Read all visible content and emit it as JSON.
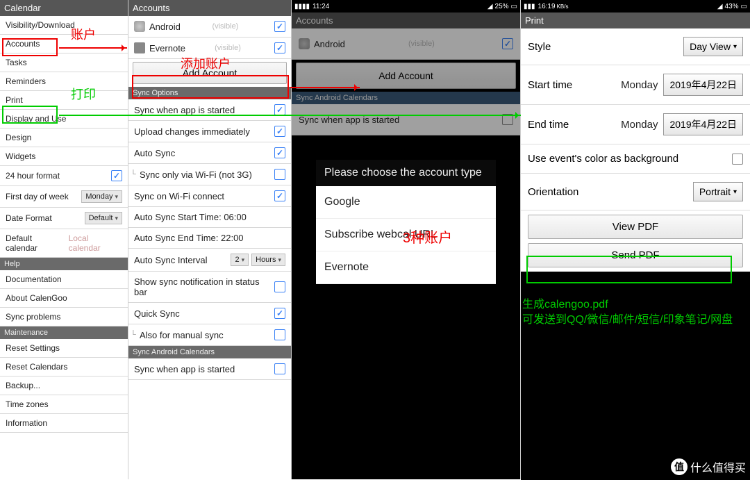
{
  "c1": {
    "hdr": "Calendar",
    "items": [
      "Visibility/Download",
      "Accounts",
      "Tasks",
      "Reminders",
      "Print",
      "Display and Use",
      "Design",
      "Widgets"
    ],
    "h24": "24 hour format",
    "fdow": "First day of week",
    "fdowv": "Monday",
    "dfmt": "Date Format",
    "dfmtv": "Default",
    "dcal": "Default calendar",
    "dcalv": "Local calendar",
    "help": "Help",
    "hitems": [
      "Documentation",
      "About CalenGoo",
      "Sync problems"
    ],
    "maint": "Maintenance",
    "mitems": [
      "Reset Settings",
      "Reset Calendars",
      "Backup...",
      "Time zones",
      "Information"
    ]
  },
  "c2": {
    "hdr": "Accounts",
    "a1": "Android",
    "a2": "Evernote",
    "vis": "(visible)",
    "add": "Add Account",
    "sync": "Sync Options",
    "o1": "Sync when app is started",
    "o2": "Upload changes immediately",
    "o3": "Auto Sync",
    "o4": "Sync only via Wi-Fi (not 3G)",
    "o5": "Sync on Wi-Fi connect",
    "o6": "Auto Sync Start Time: 06:00",
    "o7": "Auto Sync End Time: 22:00",
    "o8": "Auto Sync Interval",
    "o8a": "2",
    "o8b": "Hours",
    "o9": "Show sync notification in status bar",
    "o10": "Quick Sync",
    "o11": "Also for manual sync",
    "sac": "Sync Android Calendars",
    "o12": "Sync when app is started"
  },
  "c3": {
    "sb": "11:24",
    "sbr": "25%",
    "hdr": "Accounts",
    "a1": "Android",
    "vis": "(visible)",
    "add": "Add Account",
    "sac": "Sync Android Calendars",
    "o1": "Sync when app is started",
    "dlgh": "Please choose the account type",
    "d1": "Google",
    "d2": "Subscribe webcal URL",
    "d3": "Evernote"
  },
  "c4": {
    "sb": "16:19",
    "sbk": "KB/s",
    "sbr": "43%",
    "hdr": "Print",
    "style": "Style",
    "stylev": "Day View",
    "st": "Start time",
    "stday": "Monday",
    "stv": "2019年4月22日",
    "et": "End time",
    "etday": "Monday",
    "etv": "2019年4月22日",
    "bg": "Use event's color as background",
    "or": "Orientation",
    "orv": "Portrait",
    "view": "View PDF",
    "send": "Send PDF"
  },
  "ann": {
    "a1": "账户",
    "a2": "打印",
    "a3": "添加账户",
    "a4": "3种账户",
    "a5": "生成calengoo.pdf",
    "a6": "可发送到QQ/微信/邮件/短信/印象笔记/网盘"
  },
  "wm": "什么值得买"
}
